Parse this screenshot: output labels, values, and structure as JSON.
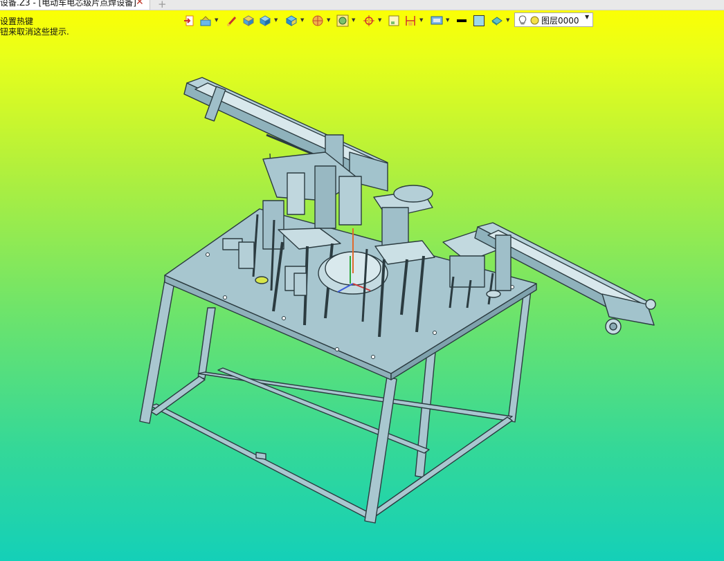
{
  "window": {
    "tab_title": "设备.Z3 - [电动车电芯级片点焊设备]",
    "tab_close": "✕",
    "new_tab": "+"
  },
  "hint": {
    "line1": "设置热键",
    "line2": "钮来取消这些提示."
  },
  "toolbar": {
    "layer_name": "图层0000",
    "color_swatch": "#9ed8e6",
    "line_color": "#000000",
    "icons": [
      "exit-icon",
      "view-tool-icon",
      "pen-tool-icon",
      "solid-box-icon",
      "cube-icon",
      "box-face-icon",
      "shaded-cube-icon",
      "sphere-icon",
      "zoom-icon",
      "crosshair-icon",
      "panel-icon",
      "dimension-icon",
      "display-icon",
      "line-color-swatch",
      "face-color-swatch",
      "render-icon",
      "bulb-icon",
      "sun-icon"
    ]
  },
  "viewport": {
    "background_top": "#ffff00",
    "background_bottom": "#14d0b8",
    "model_color": "#a9c7d0",
    "edge_color": "#2b3b40"
  }
}
